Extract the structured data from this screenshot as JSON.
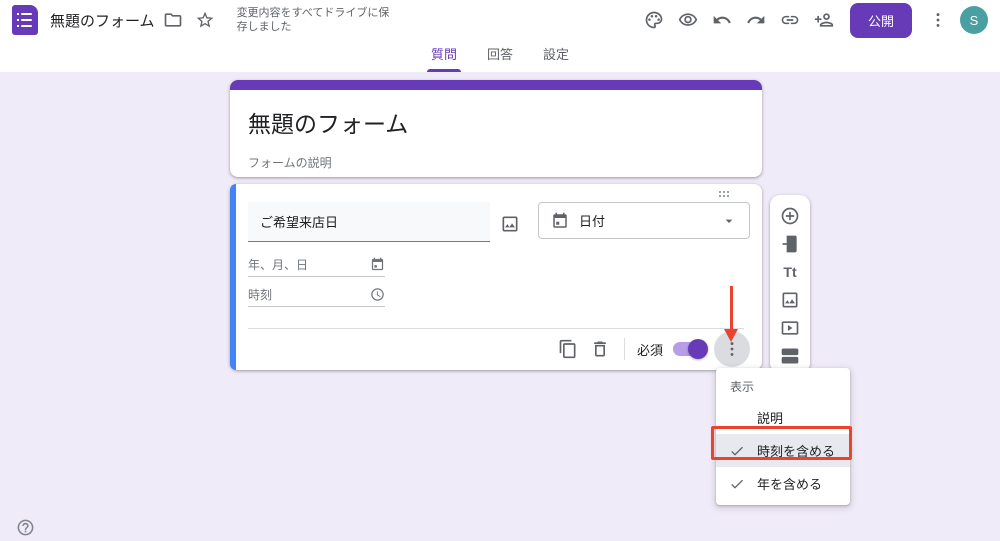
{
  "colors": {
    "accent_purple": "#673ab7",
    "page_background": "#f0ebf8",
    "question_active_border_blue": "#4285f4",
    "annotation_red": "#e8442e",
    "avatar_teal": "#4a9fa3"
  },
  "header": {
    "form_title": "無題のフォーム",
    "saved_status": "変更内容をすべてドライブに保存しました",
    "publish_button": "公開",
    "avatar_initial": "S",
    "icons": [
      "forms-logo",
      "folder-icon",
      "star-icon",
      "palette-icon",
      "preview-eye-icon",
      "undo-icon",
      "redo-icon",
      "link-icon",
      "add-collaborator-icon",
      "more-vert-icon"
    ]
  },
  "tabs": [
    {
      "label": "質問",
      "active": true
    },
    {
      "label": "回答",
      "active": false
    },
    {
      "label": "設定",
      "active": false
    }
  ],
  "form_card": {
    "title": "無題のフォーム",
    "description": "フォームの説明"
  },
  "question_card": {
    "question_title": "ご希望来店日",
    "question_type": "日付",
    "type_icon": "calendar-icon",
    "date_placeholder": "年、月、日",
    "time_placeholder": "時刻",
    "required_label": "必須",
    "required_on": true,
    "action_icons": [
      "copy-icon",
      "trash-icon",
      "more-vert-icon"
    ]
  },
  "side_toolbar": {
    "text_icon_glyph": "Tt",
    "icons": [
      "add-question-icon",
      "import-questions-icon",
      "add-title-icon",
      "add-image-icon",
      "add-video-icon",
      "add-section-icon"
    ]
  },
  "context_menu": {
    "header": "表示",
    "items": [
      {
        "label": "説明",
        "checked": false,
        "highlighted": false
      },
      {
        "label": "時刻を含める",
        "checked": true,
        "highlighted": true
      },
      {
        "label": "年を含める",
        "checked": true,
        "highlighted": false
      }
    ]
  },
  "annotations": {
    "arrow_color": "#e8442e",
    "highlight_box_color": "#e8442e"
  }
}
